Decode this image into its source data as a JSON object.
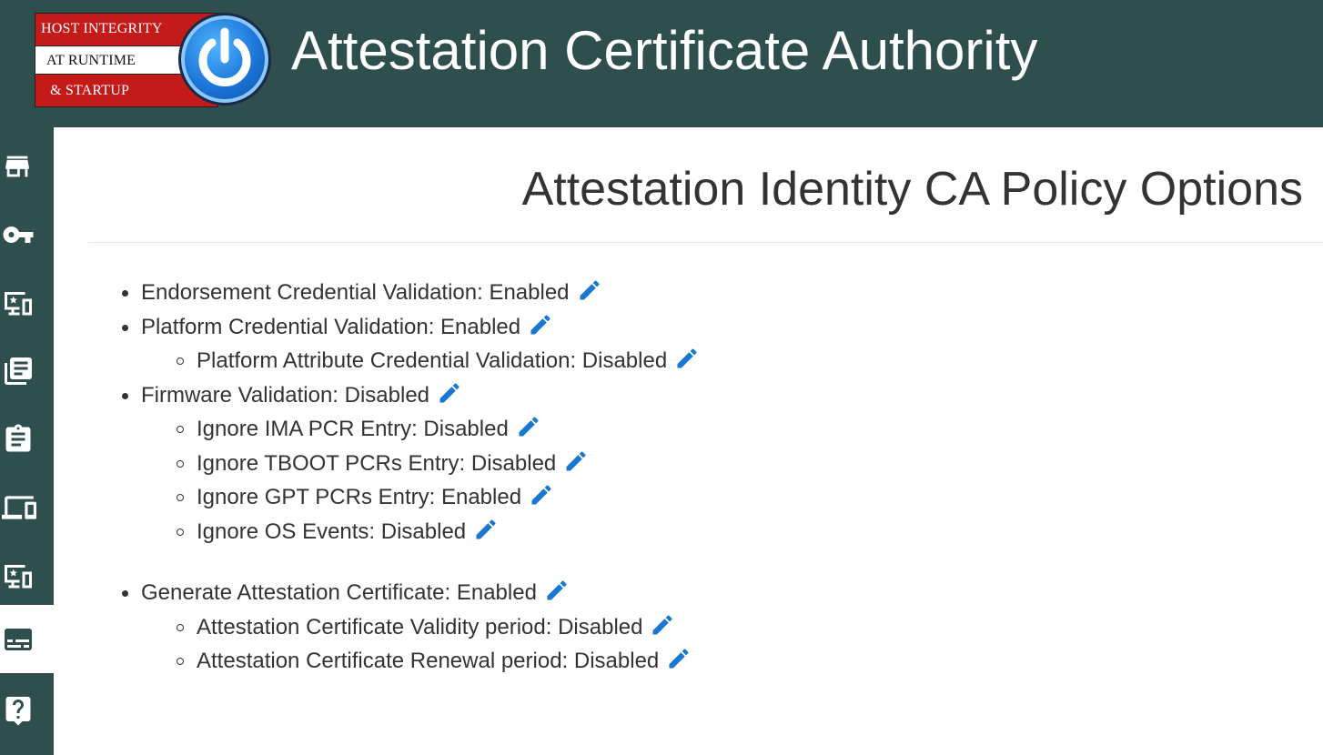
{
  "header": {
    "logo": {
      "line1": "HOST INTEGRITY",
      "line2": "AT RUNTIME",
      "line3": "& STARTUP"
    },
    "app_title": "Attestation Certificate Authority"
  },
  "sidebar": {
    "items": [
      {
        "icon": "store-icon",
        "active": false
      },
      {
        "icon": "key-icon",
        "active": false
      },
      {
        "icon": "devices-star-icon",
        "active": false
      },
      {
        "icon": "library-books-icon",
        "active": false
      },
      {
        "icon": "assignment-icon",
        "active": false
      },
      {
        "icon": "devices-icon",
        "active": false
      },
      {
        "icon": "devices-star-icon",
        "active": false
      },
      {
        "icon": "subtitles-icon",
        "active": true
      },
      {
        "icon": "help-icon",
        "active": false
      }
    ]
  },
  "main": {
    "page_title": "Attestation Identity CA Policy Options",
    "policies": [
      {
        "text": "Endorsement Credential Validation: Enabled",
        "level": 1
      },
      {
        "text": "Platform Credential Validation: Enabled",
        "level": 1
      },
      {
        "text": "Platform Attribute Credential Validation: Disabled",
        "level": 2
      },
      {
        "text": "Firmware Validation: Disabled",
        "level": 1
      },
      {
        "text": "Ignore IMA PCR Entry: Disabled",
        "level": 2
      },
      {
        "text": "Ignore TBOOT PCRs Entry: Disabled",
        "level": 2
      },
      {
        "text": "Ignore GPT PCRs Entry: Enabled",
        "level": 2
      },
      {
        "text": "Ignore OS Events: Disabled",
        "level": 2
      },
      {
        "text": "Generate Attestation Certificate: Enabled",
        "level": 1
      },
      {
        "text": "Attestation Certificate Validity period: Disabled",
        "level": 2
      },
      {
        "text": "Attestation Certificate Renewal period: Disabled",
        "level": 2
      }
    ]
  },
  "colors": {
    "header_bg": "#2f4f4f",
    "sidebar_bg": "#2f4f4f",
    "edit_icon": "#1976d2",
    "text": "#333333"
  }
}
